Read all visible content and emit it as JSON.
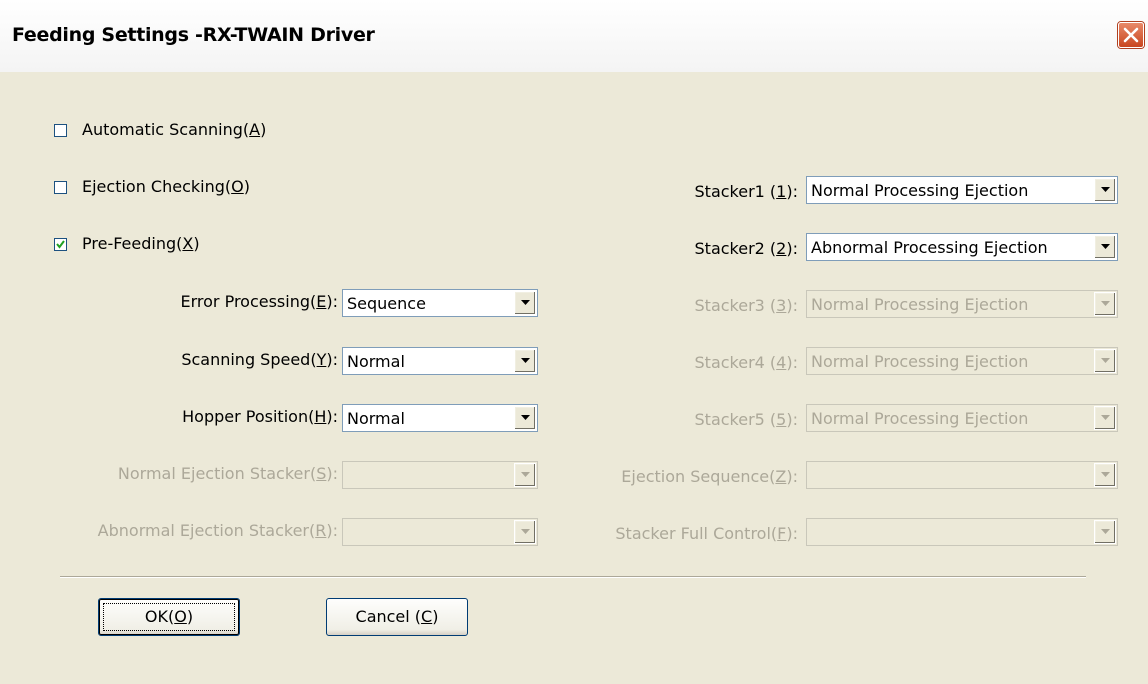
{
  "window": {
    "title": "Feeding Settings -RX-TWAIN Driver"
  },
  "checkboxes": [
    {
      "label": "Automatic Scanning(",
      "key": "A",
      "tail": ")",
      "checked": false
    },
    {
      "label": "Ejection Checking(",
      "key": "O",
      "tail": ")",
      "checked": false
    },
    {
      "label": "Pre-Feeding(",
      "key": "X",
      "tail": ")",
      "checked": true
    }
  ],
  "left_fields": [
    {
      "label": "Error Processing(",
      "key": "E",
      "tail": "):",
      "value": "Sequence",
      "enabled": true
    },
    {
      "label": "Scanning Speed(",
      "key": "Y",
      "tail": "):",
      "value": "Normal",
      "enabled": true
    },
    {
      "label": "Hopper Position(",
      "key": "H",
      "tail": "):",
      "value": "Normal",
      "enabled": true
    },
    {
      "label": "Normal Ejection Stacker(",
      "key": "S",
      "tail": "):",
      "value": "",
      "enabled": false
    },
    {
      "label": "Abnormal Ejection Stacker(",
      "key": "R",
      "tail": "):",
      "value": "",
      "enabled": false
    }
  ],
  "right_fields": [
    {
      "label": "Stacker1 (",
      "key": "1",
      "tail": "):",
      "value": "Normal Processing Ejection",
      "enabled": true
    },
    {
      "label": "Stacker2 (",
      "key": "2",
      "tail": "):",
      "value": "Abnormal Processing Ejection",
      "enabled": true
    },
    {
      "label": "Stacker3 (",
      "key": "3",
      "tail": "):",
      "value": "Normal Processing Ejection",
      "enabled": false
    },
    {
      "label": "Stacker4 (",
      "key": "4",
      "tail": "):",
      "value": "Normal Processing Ejection",
      "enabled": false
    },
    {
      "label": "Stacker5 (",
      "key": "5",
      "tail": "):",
      "value": "Normal Processing Ejection",
      "enabled": false
    },
    {
      "label": "Ejection Sequence(",
      "key": "Z",
      "tail": "):",
      "value": "",
      "enabled": false
    },
    {
      "label": "Stacker Full Control(",
      "key": "F",
      "tail": "):",
      "value": "",
      "enabled": false
    }
  ],
  "buttons": {
    "ok": {
      "label": "OK(",
      "key": "O",
      "tail": ")"
    },
    "cancel": {
      "label": "Cancel (",
      "key": "C",
      "tail": ")"
    }
  }
}
